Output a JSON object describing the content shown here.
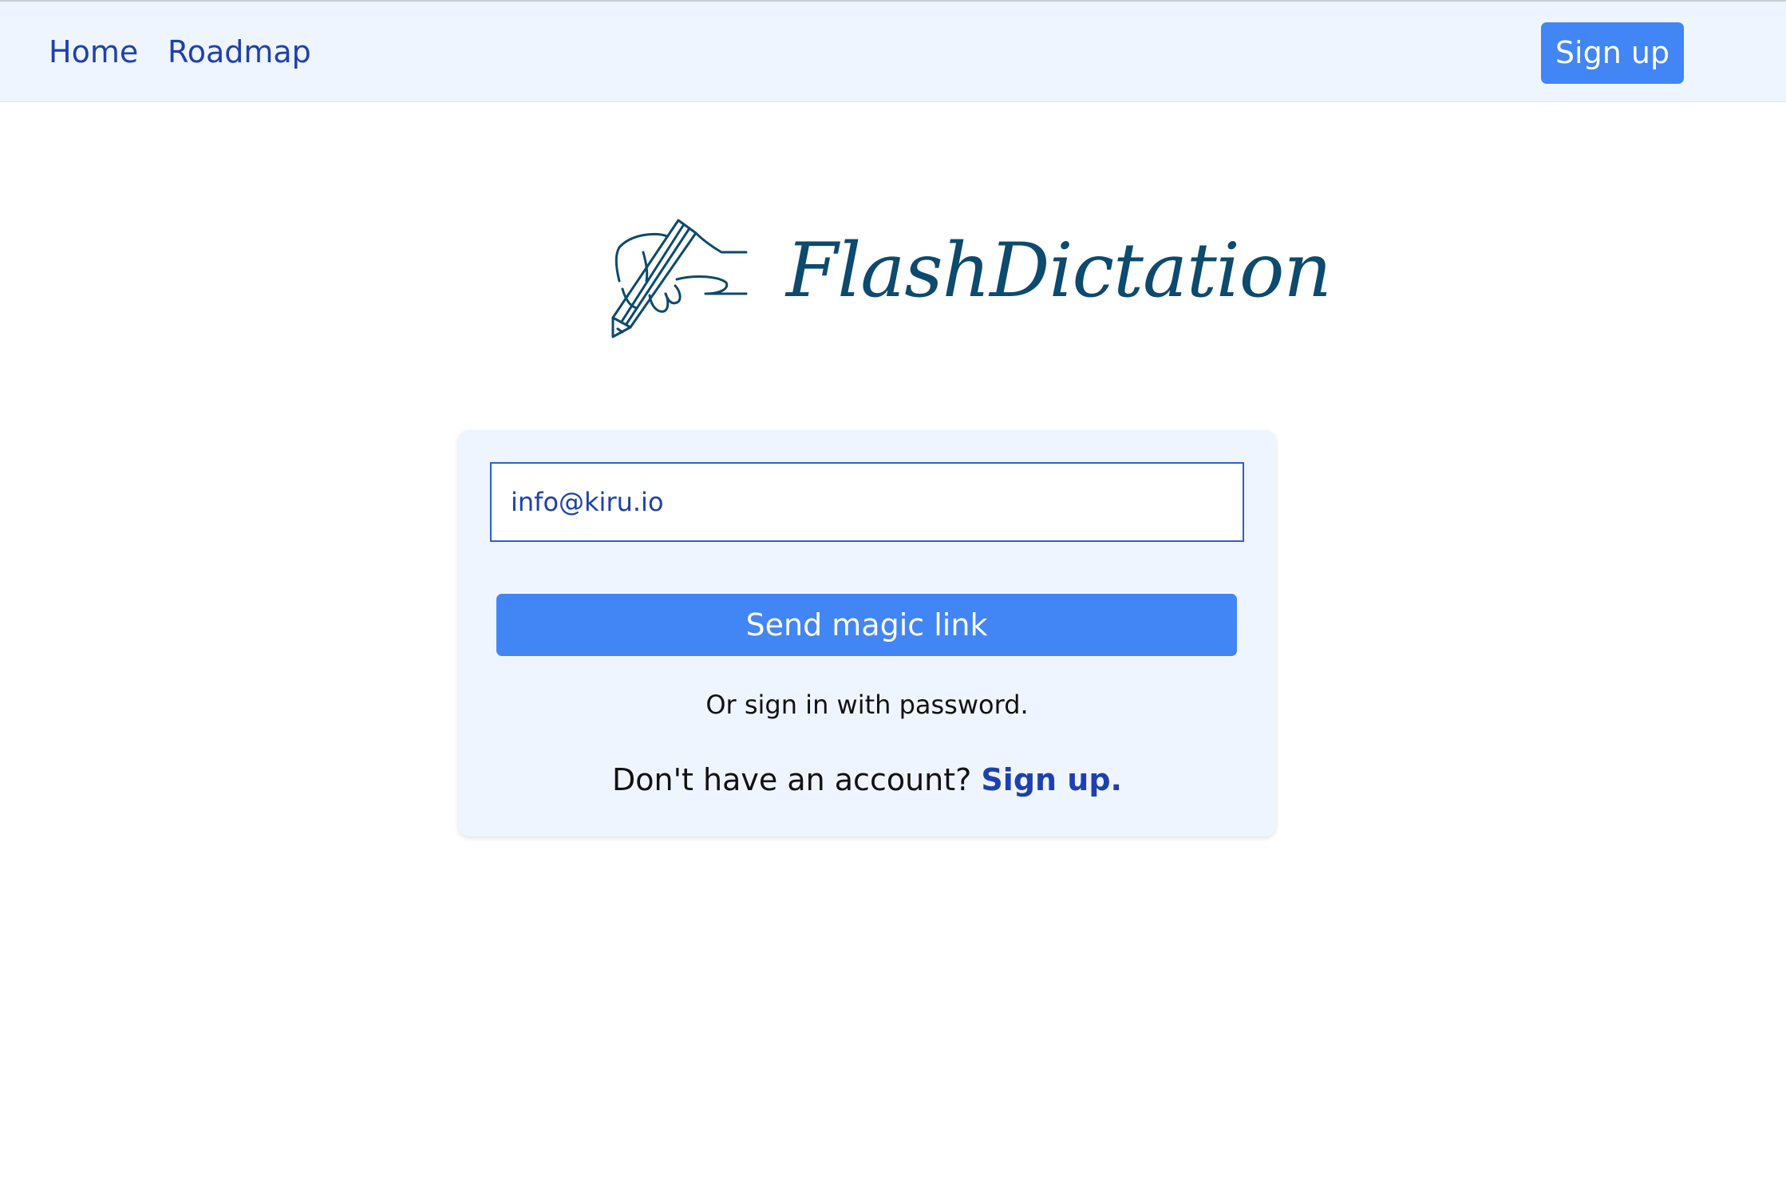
{
  "nav": {
    "home_label": "Home",
    "roadmap_label": "Roadmap",
    "signup_label": "Sign up"
  },
  "brand": {
    "name": "FlashDictation",
    "icon": "hand-writing-pencil-icon",
    "color": "#0c4a6e"
  },
  "login": {
    "email_value": "info@kiru.io",
    "magic_link_label": "Send magic link",
    "password_text": "Or sign in with password.",
    "no_account_text": "Don't have an account?",
    "signup_link_label": "Sign up."
  },
  "colors": {
    "accent": "#4285f4",
    "link": "#1e40af",
    "panel_bg": "#eff5fe"
  }
}
